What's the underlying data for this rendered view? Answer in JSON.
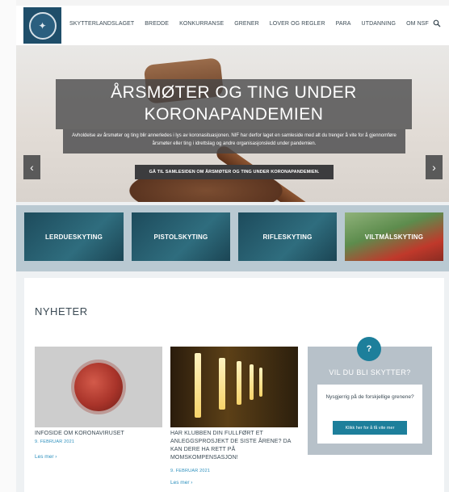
{
  "header": {
    "nav": [
      "SKYTTERLANDSLAGET",
      "BREDDE",
      "KONKURRANSE",
      "GRENER",
      "LOVER OG REGLER",
      "PARA",
      "UTDANNING",
      "OM NSF"
    ]
  },
  "hero": {
    "title": "ÅRSMØTER OG TING UNDER KORONAPANDEMIEN",
    "subtitle": "Avholdelse av årsmøter og ting blir annerledes i lys av koronasituasjonen. NIF har derfor laget en samleside med alt du trenger å vite for å gjennomføre årsmøter eller ting i idrettslag og andre organisasjonsledd under pandemien.",
    "button": "GÅ TIL SAMLESIDEN OM ÅRSMØTER OG TING UNDER KORONAPANDEMIEN.",
    "prev_arrow": "‹",
    "next_arrow": "›"
  },
  "categories": [
    "LERDUESKYTING",
    "PISTOLSKYTING",
    "RIFLESKYTING",
    "VILTMÅLSKYTING"
  ],
  "news": {
    "heading": "NYHETER",
    "articles": [
      {
        "title": "INFOSIDE OM KORONAVIRUSET",
        "date": "9. FEBRUAR 2021",
        "more": "Les mer ›"
      },
      {
        "title": "HAR KLUBBEN DIN FULLFØRT ET ANLEGGSPROSJEKT DE SISTE ÅRENE? DA KAN DERE HA RETT PÅ MOMSKOMPENSASJON!",
        "date": "9. FEBRUAR 2021",
        "more": "Les mer ›"
      }
    ],
    "sidebar": {
      "icon": "?",
      "title": "VIL DU BLI SKYTTER?",
      "text": "Nysgjerrig på de forskjellige grenene?",
      "button": "Klikk her for å få vite mer"
    }
  },
  "colors": {
    "accent": "#1d7f9b",
    "link": "#2b8fbd",
    "logo_bg": "#1f4e6a"
  }
}
